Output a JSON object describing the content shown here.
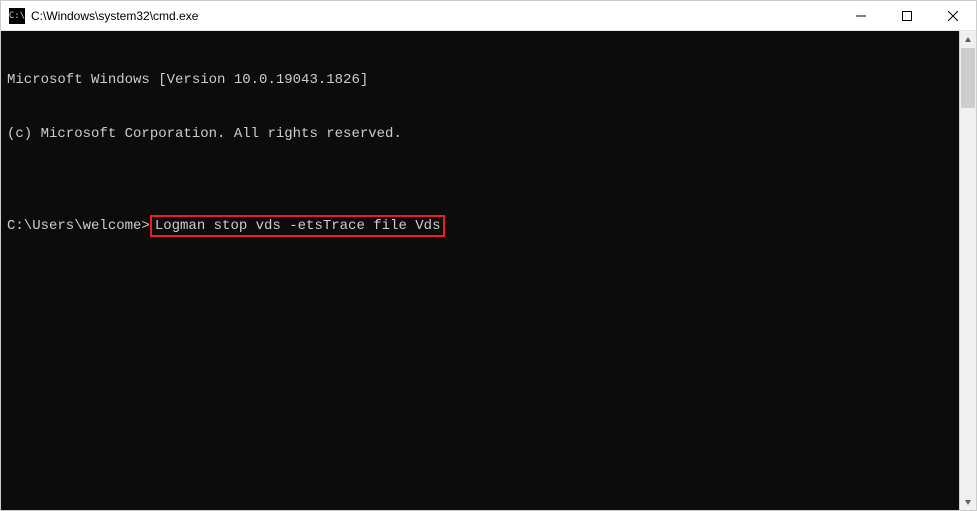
{
  "titlebar": {
    "icon_label": "C:\\",
    "title": "C:\\Windows\\system32\\cmd.exe"
  },
  "console": {
    "line1": "Microsoft Windows [Version 10.0.19043.1826]",
    "line2": "(c) Microsoft Corporation. All rights reserved.",
    "blank": "",
    "prompt": "C:\\Users\\welcome>",
    "command": "Logman stop vds -etsTrace file Vds"
  },
  "highlight": {
    "color": "#ed1c24"
  }
}
